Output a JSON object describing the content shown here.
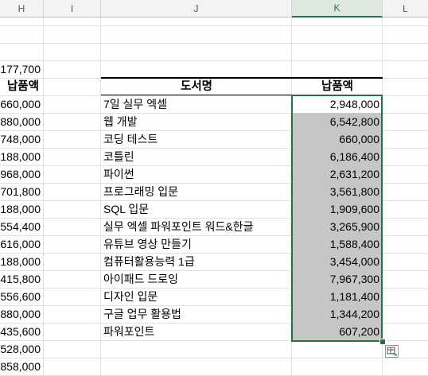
{
  "columns": {
    "h": "H",
    "i": "I",
    "j": "J",
    "k": "K",
    "l": "L"
  },
  "col_h_partial": {
    "top_value": "177,700",
    "header": "납품액",
    "values": [
      "660,000",
      "880,000",
      "748,000",
      "188,000",
      "968,000",
      "701,800",
      "188,000",
      "554,400",
      "616,000",
      "188,000",
      "415,800",
      "556,600",
      "880,000",
      "435,600",
      "528,000",
      "858,000"
    ]
  },
  "table": {
    "header_book": "도서명",
    "header_amount": "납품액",
    "rows": [
      {
        "book": "7일 실무 엑셀",
        "amount": "2,948,000"
      },
      {
        "book": "웹 개발",
        "amount": "6,542,800"
      },
      {
        "book": "코딩 테스트",
        "amount": "660,000"
      },
      {
        "book": "코틀린",
        "amount": "6,186,400"
      },
      {
        "book": "파이썬",
        "amount": "2,631,200"
      },
      {
        "book": "프로그래밍 입문",
        "amount": "3,561,800"
      },
      {
        "book": "SQL 입문",
        "amount": "1,909,600"
      },
      {
        "book": "실무 엑셀 파워포인트 워드&한글",
        "amount": "3,265,900"
      },
      {
        "book": "유튜브 영상 만들기",
        "amount": "1,588,400"
      },
      {
        "book": "컴퓨터활용능력 1급",
        "amount": "3,454,000"
      },
      {
        "book": "아이패드 드로잉",
        "amount": "7,967,300"
      },
      {
        "book": "디자인 입문",
        "amount": "1,181,400"
      },
      {
        "book": "구글 업무 활용법",
        "amount": "1,344,200"
      },
      {
        "book": "파워포인트",
        "amount": "607,200"
      }
    ]
  },
  "colors": {
    "selection": "#217346",
    "shade": "#c6c6c6"
  }
}
